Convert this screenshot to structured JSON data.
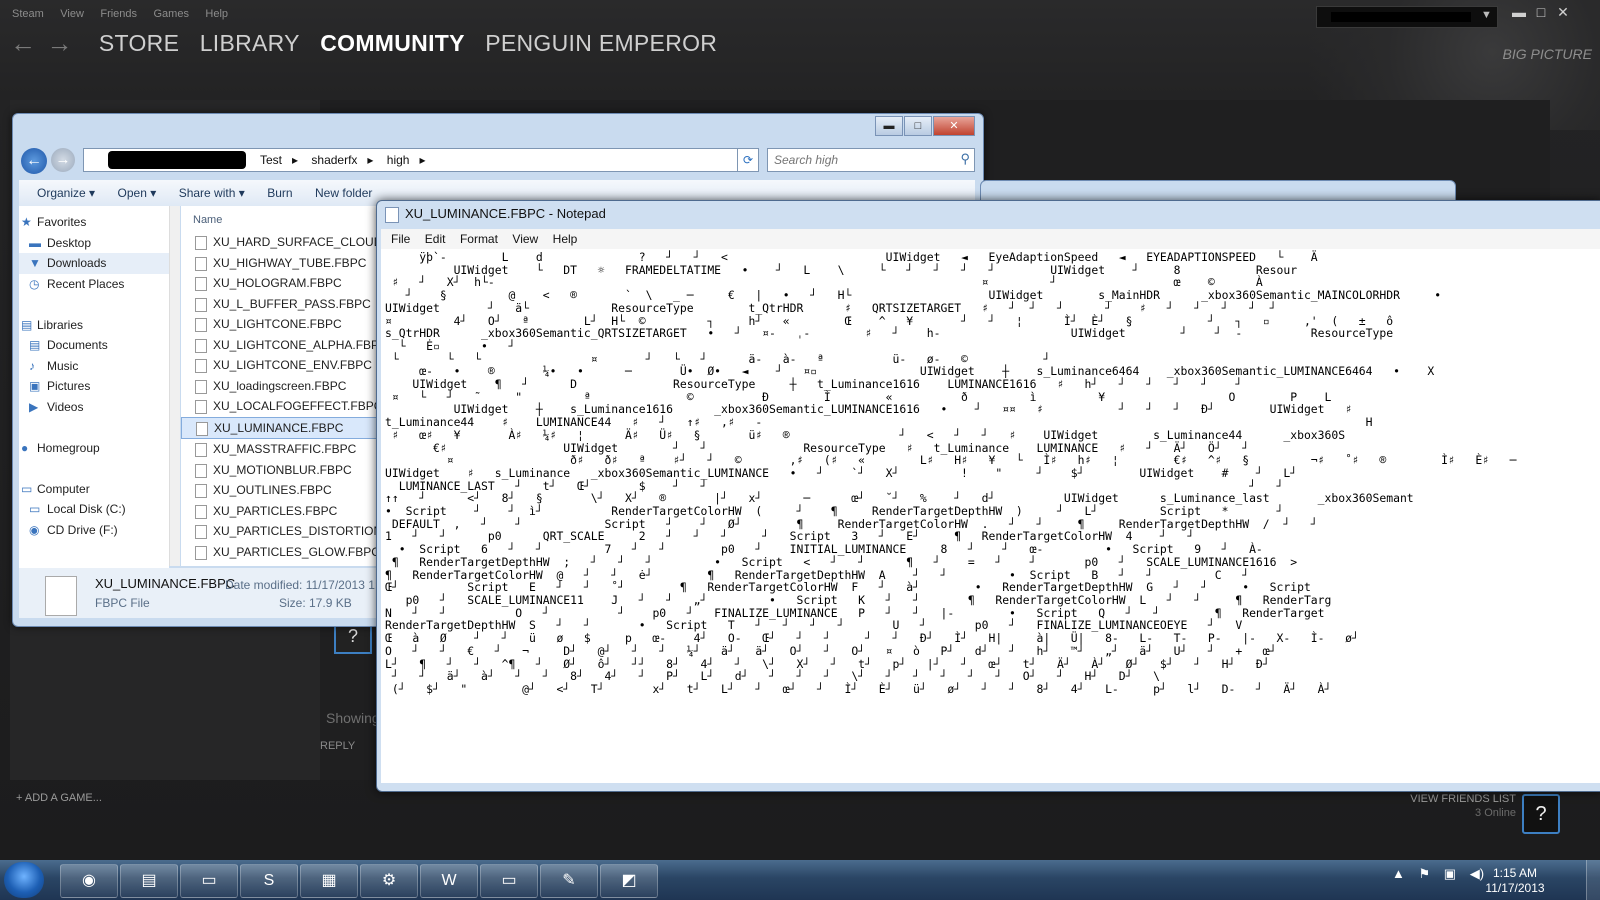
{
  "steam": {
    "menu": [
      "Steam",
      "View",
      "Friends",
      "Games",
      "Help"
    ],
    "nav_tabs": [
      "STORE",
      "LIBRARY",
      "COMMUNITY",
      "PENGUIN EMPEROR"
    ],
    "active_tab": "COMMUNITY",
    "big_picture": "BIG PICTURE",
    "add_game": "+ ADD A GAME...",
    "view_friends": "VIEW FRIENDS LIST",
    "online": "3 Online",
    "showing": "Showing",
    "reply": "REPLY",
    "help": "?",
    "window_buttons": [
      "▬",
      "□",
      "✕"
    ]
  },
  "explorer": {
    "breadcrumbs": [
      "Test",
      "shaderfx",
      "high"
    ],
    "search_placeholder": "Search high",
    "toolbar": [
      "Organize ▾",
      "Open ▾",
      "Share with ▾",
      "Burn",
      "New folder"
    ],
    "nav": [
      {
        "label": "Favorites",
        "head": true,
        "icon": "★"
      },
      {
        "label": "Desktop",
        "icon": "▬"
      },
      {
        "label": "Downloads",
        "icon": "▼",
        "selected": true
      },
      {
        "label": "Recent Places",
        "icon": "◷"
      },
      {
        "label": "",
        "icon": ""
      },
      {
        "label": "Libraries",
        "head": true,
        "icon": "▤"
      },
      {
        "label": "Documents",
        "icon": "▤"
      },
      {
        "label": "Music",
        "icon": "♪"
      },
      {
        "label": "Pictures",
        "icon": "▣"
      },
      {
        "label": "Videos",
        "icon": "▶"
      },
      {
        "label": "",
        "icon": ""
      },
      {
        "label": "Homegroup",
        "head": true,
        "icon": "●"
      },
      {
        "label": "",
        "icon": ""
      },
      {
        "label": "Computer",
        "head": true,
        "icon": "▭"
      },
      {
        "label": "Local Disk (C:)",
        "icon": "▭"
      },
      {
        "label": "CD Drive (F:)",
        "icon": "◉"
      }
    ],
    "column_header": "Name",
    "files": [
      "XU_HARD_SURFACE_CLOUDS.F",
      "XU_HIGHWAY_TUBE.FBPC",
      "XU_HOLOGRAM.FBPC",
      "XU_L_BUFFER_PASS.FBPC",
      "XU_LIGHTCONE.FBPC",
      "XU_LIGHTCONE_ALPHA.FBPC",
      "XU_LIGHTCONE_ENV.FBPC",
      "XU_loadingscreen.FBPC",
      "XU_LOCALFOGEFFECT.FBPC",
      "XU_LUMINANCE.FBPC",
      "XU_MASSTRAFFIC.FBPC",
      "XU_MOTIONBLUR.FBPC",
      "XU_OUTLINES.FBPC",
      "XU_PARTICLES.FBPC",
      "XU_PARTICLES_DISTORTION.FB",
      "XU_PARTICLES_GLOW.FBPC"
    ],
    "selected_file": "XU_LUMINANCE.FBPC",
    "details": {
      "name": "XU_LUMINANCE.FBPC",
      "modified": "Date modified: 11/17/2013 1:",
      "type": "FBPC File",
      "size": "Size: 17.9 KB"
    },
    "window_buttons": [
      "▬",
      "□",
      "✕"
    ]
  },
  "notepad": {
    "title": "XU_LUMINANCE.FBPC - Notepad",
    "menu": [
      "File",
      "Edit",
      "Format",
      "View",
      "Help"
    ],
    "content": "     ÿþ`-        L    d              ?   ┘   ┘   <                       UIWidget   ◄   EyeAdaptionSpeed   ◄   EYEADAPTIONSPEED   └    Ä\n          UIWidget    └   DT   ☼   FRAMEDELTATIME   •    ┘   L    \\     └   ┘   ┘   ┘   ┘        UIWidget    ┘     8           Resour\n ♯   ┘   X┘  h└-                                                                       ¤         ┘                 œ    ©      À\n   ┘    §         @    <   ®       `  \\   _ ─     €   |   •   ┘   H└                    UIWidget        s_MainHDR      _xbox360Semantic_MAINCOLORHDR     •\nUIWidget       ┘   ä└            ResourceType        t_QtrHDR      ♯   QRTSIZETARGET   ♯   ┘  ┘   ┘      ┘    ♯   ┘   ┘   ┘   ┘  ┘\n¤         4┘   O┘   ª        L┘  H└  ©         ┐     h┘   «        Œ    ^   ¥       ┘   ┘   ¦      Ì┘  È┘   §           ┘   ┐   ▫     ,'  (   ±   ô\ns_QtrHDR      _xbox360Semantic_QRTSIZETARGET   •   ┘   ¤-   ˌ-        ♯   ┘    h-                   UIWidget        ┘    ┘  -          ResourceType\n  └   Ė▫      •   ┘\n └       └   └                ¤       ┘   └   ┘      ä-   à-   ª          ü-   ø-   ©           ┘\n     œ-   •    ®       ¼•   •      ─       Ü•  Ø•   ◄    ┘   ¤▫               UIWidget    ┼    s_Luminance6464    _xbox360Semantic_LUMINANCE6464   •    X\n    UIWidget    ¶   ┘      D              ResourceType     ┼   t_Luminance1616    LUMINANCE1616   ♯   h┘   ┘   ┘   ┘   ┘    ┘\n ¤   └   ┘   ˜     \"         ª              ©          Ð        Ì        «          ð         ì         ¥                  O        P    L\n          UIWidget    ┼    s_Luminance1616      _xbox360Semantic_LUMINANCE1616   •    ┘   ¤¤   ♯           ┘   ┘   ┘   Ð┘        UIWidget   ♯\nt_Luminance44    ♯    LUMINANCE44   ♯   ┘   ↑♯   ,♯   -                                                                                        H\n ♯   œ♯   ¥       À♯   ¼♯   ¦      Ä♯   Ü♯   §       ü♯   ®                ┘   <   ┘   ┘   ♯    UIWidget        s_Luminance44      _xbox360S\n       €♯                 UIWidget        ┘   ┘              ResourceType   ♯   t_Luminance    LUMINANCE   ♯   ┘   Ä┘   Ö┘   ┘\n         ¤                 ð♯   ð♯   ª    ♯┘   ┘   ©       ,♯   (♯   «        L♯   H♯   ¥   └   Ì♯   h♯   ¦        €♯   ^♯   §         ¬♯   ˚♯   ®        Ì♯   È♯   ─\nUIWidget    ♯   s_Luminance   _xbox360Semantic_LUMINANCE   •   ┘    `┘   X┘         !    \"     ┘    $┘        UIWidget    #    ┘   L┘\n  LUMINANCE_LAST   ┘   t┘   Œ┘       $    ┘   ┘                                                                               ┘   ┘\n↑↑   ┘      <┘   8┘   §       \\┘   X┘   ®       |┘   x┘      ─      œ┘   ˘┘   %    ┘   d┘          UIWidget      s_Luminance_last       _xbox360Semant\n•  Script    ┘    ┘  ì┘          RenderTargetColorHW  (     ┘    ¶     RenderTargetDepthHW  )     ┘   L┘         Script   *       ┘\n DEFAULT  ,   ┘    ┘            Script   ┘    ┘   Ø┘        ¶     RenderTargetColorHW  .   ┘   ┘     ¶     RenderTargetDepthHW  /  ┘   ┘\n1   ┘   ┘      p0      QRT_SCALE     2   ┘   ┘   ┘     ┘   Script   3   ┘   E┘     ¶   RenderTargetColorHW  4    ┘   ┘\n  •  Script   6   ┘   ┘         7   ┘   ┘        p0   ┘    INITIAL_LUMINANCE     8   ┘    ┘   œ-         •   Script   9   ┘   À-\n ¶   RenderTargetDepthHW  ;   ┘   ┘   ┘         •   Script   <   ┘   ┘      ¶   ┘    =   ┘    ┘       p0   ┘   SCALE_LUMINANCE1616  >\n¶   RenderTargetColorHW  @   ┘   ┘   ė┘        ¶   RenderTargetDepthHW  A    ┘   ┘         •  Script   B   ┘   ┘         C   ┘\nŒ┘          Script   E   ┘   ┘   ˚┘        ¶   RenderTargetColorHW  F   ┘   à┘        •   RenderTargetDepthHW  G   ┘   ┘     •   Script\n   p0   ┘   SCALE_LUMINANCE11    J   ┘   ┘   „┘         •   Script   K   ┘   ┘       ¶   RenderTargetColorHW  L   ┘   ┘     ¶   RenderTarg\nN   ┘   ┘          O   ┘          ┘    p0   ┘   FINALIZE_LUMINANCE   P   ┘   ┘   |-        •   Script   Q   ┘   ┘        ¶   RenderTarget\nRenderTargetDepthHW  S   ┘   ┘       •   Script   T   ┘   ┘   ┘   ┘       U   ┘       p0   ┘   FINALIZE_LUMINANCEOEYE   ┘   V\nŒ   à   Ø    ┘   ┘   ü   ø   $     p   œ-    4┘   O-   Œ┘   ┘   ┘     ┘   ┘   Ð┘   Ì┘   H|     à|   Ü|   8-   L-   T-   P-   |-   X-   Ì-   ø┘\nO   ┘   ┘   €   ┘   ¬     D┘   @┘   ┘   ┘   ¼┘   ä┘   ä┘   O┘   ┘   O┘   ¤   ò   P┘   d┘   ┘   h┘   ™┘   „┘   ä┘   U┘   ┘   +   œ┘\nL┘   ¶   ┘   ┘   ^¶   ┘   Ø┘   ô┘   ┘┘   8┘   4┘   ┘   \\┘   X┘   ┘   t┘   p┘   |┘   ┘   œ┘   t┘   Ä┘   À┘   Ø┘   $┘   ┘   H┘   Ð┘\n ┘   ┘   ä┘   à┘   ┘   ┘   8┘   4┘   ┘   P┘   L┘   d┘   ┘   ┘   ┘   \\┘   ┘   ┘   ┘   ┘   ┘   O┘   ┘   H┘   D┘   \\\n (┘   $┘   \"        @┘   <┘   T┘       x┘   t┘   L┘   ┘   œ┘   ┘   Ì┘   È┘   ü┘   ø┘   ┘   ┘   8┘   4┘   L-     p┘   l┘   D-   ┘   Ä┘   À┘"
  },
  "taskbar": {
    "apps": [
      "Chrome",
      "Windows Explorer",
      "Sticky Notes",
      "Skype",
      "Control Panel",
      "Steam",
      "Word",
      "Command Prompt",
      "Editor",
      "Paint"
    ],
    "time": "1:15 AM",
    "date": "11/17/2013"
  }
}
